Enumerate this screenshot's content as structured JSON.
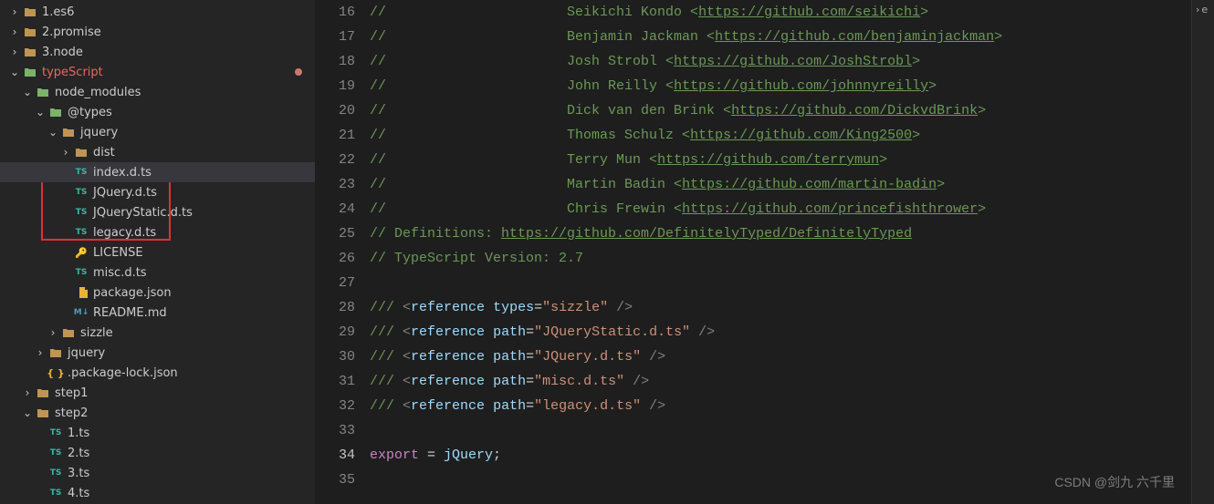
{
  "sidebar": {
    "items": [
      {
        "indent": 0,
        "chev": "right",
        "icon": "folder",
        "iconClass": "ic-folder",
        "label": "1.es6"
      },
      {
        "indent": 0,
        "chev": "right",
        "icon": "folder",
        "iconClass": "ic-folder",
        "label": "2.promise"
      },
      {
        "indent": 0,
        "chev": "right",
        "icon": "folder",
        "iconClass": "ic-folder",
        "label": "3.node"
      },
      {
        "indent": 0,
        "chev": "down",
        "icon": "folder-ts",
        "iconClass": "ic-folder-green",
        "label": "typeScript",
        "active": true,
        "dot": true
      },
      {
        "indent": 1,
        "chev": "down",
        "icon": "folder-node",
        "iconClass": "ic-folder-green",
        "label": "node_modules"
      },
      {
        "indent": 2,
        "chev": "down",
        "icon": "folder-at",
        "iconClass": "ic-folder-green",
        "label": "@types"
      },
      {
        "indent": 3,
        "chev": "down",
        "icon": "folder",
        "iconClass": "ic-folder",
        "label": "jquery"
      },
      {
        "indent": 4,
        "chev": "right",
        "icon": "folder",
        "iconClass": "ic-folder",
        "label": "dist"
      },
      {
        "indent": 4,
        "chev": "none",
        "icon": "TS",
        "iconClass": "ic-ts",
        "label": "index.d.ts",
        "selected": true
      },
      {
        "indent": 4,
        "chev": "none",
        "icon": "TS",
        "iconClass": "ic-ts",
        "label": "JQuery.d.ts"
      },
      {
        "indent": 4,
        "chev": "none",
        "icon": "TS",
        "iconClass": "ic-ts",
        "label": "JQueryStatic.d.ts"
      },
      {
        "indent": 4,
        "chev": "none",
        "icon": "TS",
        "iconClass": "ic-ts",
        "label": "legacy.d.ts"
      },
      {
        "indent": 4,
        "chev": "none",
        "icon": "key",
        "iconClass": "ic-key",
        "label": "LICENSE"
      },
      {
        "indent": 4,
        "chev": "none",
        "icon": "TS",
        "iconClass": "ic-ts",
        "label": "misc.d.ts"
      },
      {
        "indent": 4,
        "chev": "none",
        "icon": "json",
        "iconClass": "ic-json",
        "label": "package.json"
      },
      {
        "indent": 4,
        "chev": "none",
        "icon": "M↓",
        "iconClass": "ic-md",
        "label": "README.md"
      },
      {
        "indent": 3,
        "chev": "right",
        "icon": "folder",
        "iconClass": "ic-folder",
        "label": "sizzle"
      },
      {
        "indent": 2,
        "chev": "right",
        "icon": "folder",
        "iconClass": "ic-folder",
        "label": "jquery"
      },
      {
        "indent": 2,
        "chev": "none",
        "icon": "{ }",
        "iconClass": "ic-json",
        "label": ".package-lock.json"
      },
      {
        "indent": 1,
        "chev": "right",
        "icon": "folder",
        "iconClass": "ic-folder",
        "label": "step1"
      },
      {
        "indent": 1,
        "chev": "down",
        "icon": "folder",
        "iconClass": "ic-folder",
        "label": "step2"
      },
      {
        "indent": 2,
        "chev": "none",
        "icon": "TS",
        "iconClass": "ic-ts",
        "label": "1.ts"
      },
      {
        "indent": 2,
        "chev": "none",
        "icon": "TS",
        "iconClass": "ic-ts",
        "label": "2.ts"
      },
      {
        "indent": 2,
        "chev": "none",
        "icon": "TS",
        "iconClass": "ic-ts",
        "label": "3.ts"
      },
      {
        "indent": 2,
        "chev": "none",
        "icon": "TS",
        "iconClass": "ic-ts",
        "label": "4.ts"
      }
    ]
  },
  "editor": {
    "startLine": 16,
    "currentLine": 34,
    "lines": [
      {
        "type": "author",
        "name": "Seikichi Kondo",
        "url": "https://github.com/seikichi"
      },
      {
        "type": "author",
        "name": "Benjamin Jackman",
        "url": "https://github.com/benjaminjackman"
      },
      {
        "type": "author",
        "name": "Josh Strobl",
        "url": "https://github.com/JoshStrobl"
      },
      {
        "type": "author",
        "name": "John Reilly",
        "url": "https://github.com/johnnyreilly"
      },
      {
        "type": "author",
        "name": "Dick van den Brink",
        "url": "https://github.com/DickvdBrink"
      },
      {
        "type": "author",
        "name": "Thomas Schulz",
        "url": "https://github.com/King2500"
      },
      {
        "type": "author",
        "name": "Terry Mun",
        "url": "https://github.com/terrymun"
      },
      {
        "type": "author",
        "name": "Martin Badin",
        "url": "https://github.com/martin-badin"
      },
      {
        "type": "author",
        "name": "Chris Frewin",
        "url": "https://github.com/princefishthrower"
      },
      {
        "type": "definitions",
        "label": "// Definitions: ",
        "url": "https://github.com/DefinitelyTyped/DefinitelyTyped"
      },
      {
        "type": "plain",
        "text": "// TypeScript Version: 2.7"
      },
      {
        "type": "blank"
      },
      {
        "type": "ref",
        "attr": "types",
        "val": "sizzle"
      },
      {
        "type": "ref",
        "attr": "path",
        "val": "JQueryStatic.d.ts"
      },
      {
        "type": "ref",
        "attr": "path",
        "val": "JQuery.d.ts"
      },
      {
        "type": "ref",
        "attr": "path",
        "val": "misc.d.ts"
      },
      {
        "type": "ref",
        "attr": "path",
        "val": "legacy.d.ts"
      },
      {
        "type": "blank"
      },
      {
        "type": "export",
        "kw": "export",
        "eq": " = ",
        "var": "jQuery",
        "semi": ";"
      },
      {
        "type": "blank"
      }
    ]
  },
  "watermark": "CSDN @剑九 六千里",
  "breadcrumb": "e"
}
